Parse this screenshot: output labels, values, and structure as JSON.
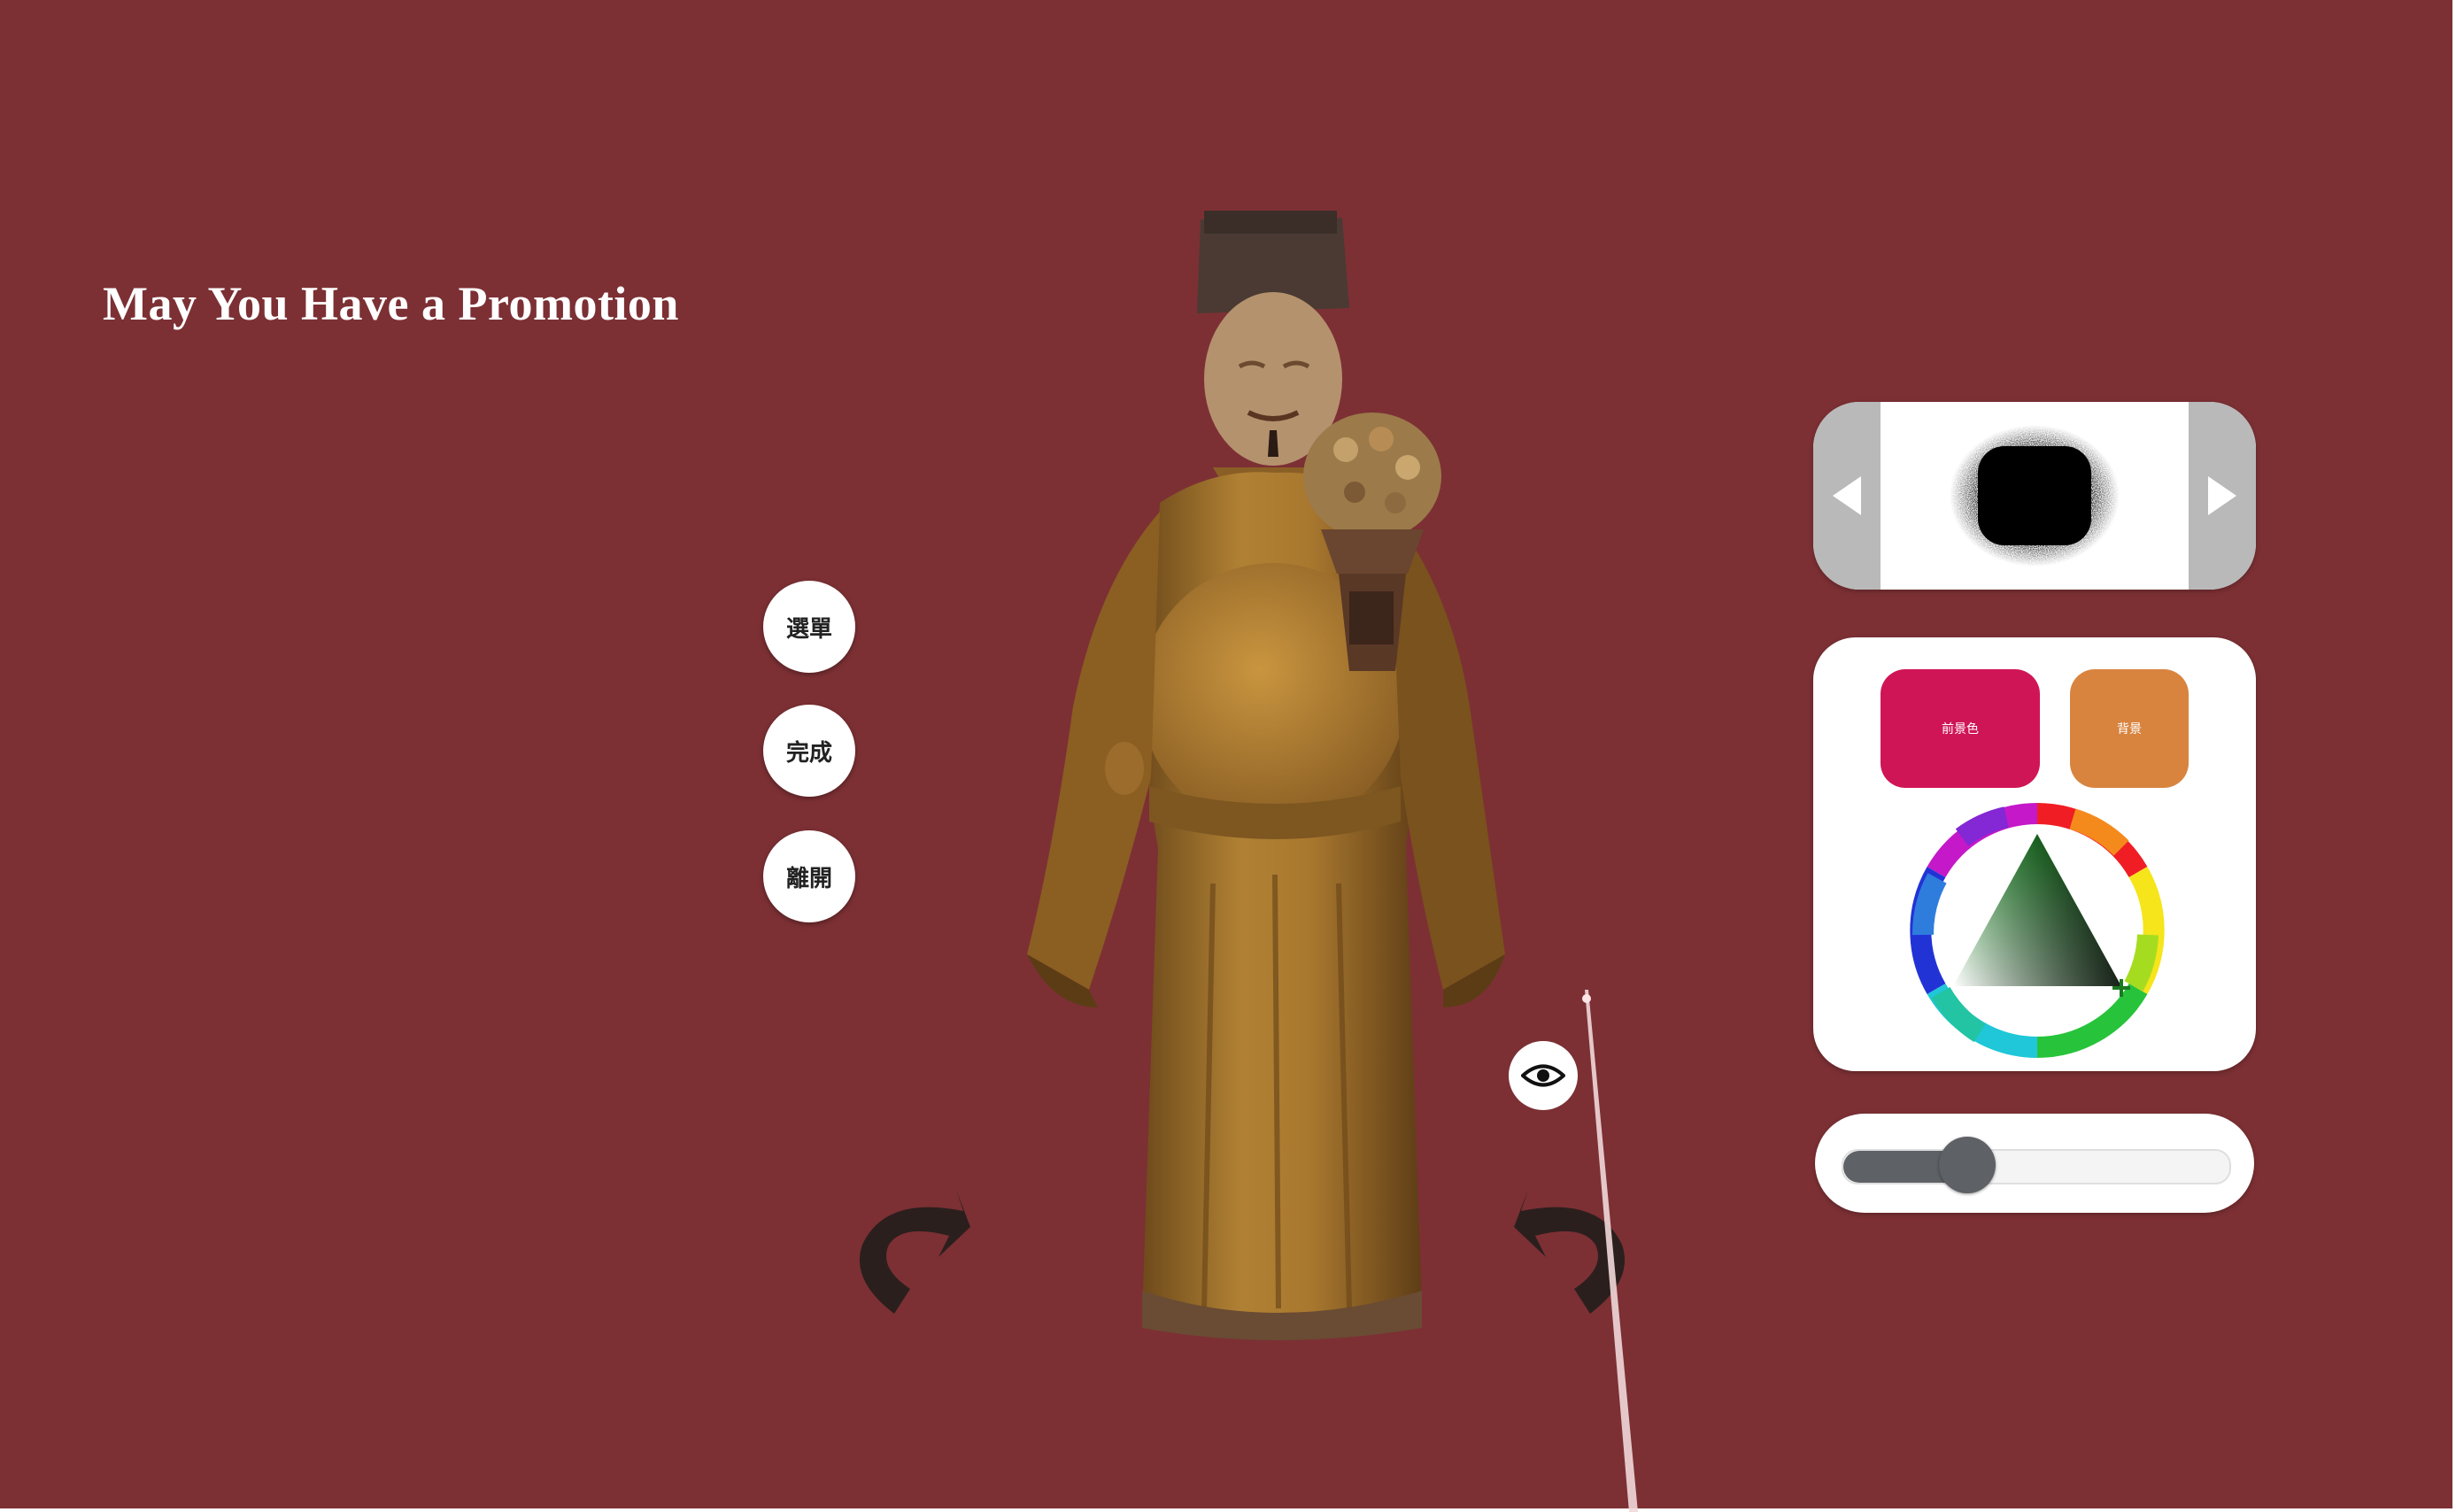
{
  "title": "May You Have a Promotion",
  "menu": {
    "menu_label": "選單",
    "done_label": "完成",
    "exit_label": "離開"
  },
  "tools": {
    "swatch_primary_label": "前景色",
    "swatch_secondary_label": "背景",
    "primary_color": "#cf1556",
    "secondary_color": "#d8843f"
  },
  "slider": {
    "level": 0.28
  },
  "icons": {
    "eye": "eye-icon",
    "rotate_left": "rotate-left-icon",
    "rotate_right": "rotate-right-icon",
    "prev": "triangle-left-icon",
    "next": "triangle-right-icon"
  },
  "colors": {
    "background": "#7c3034",
    "statue_robe": "#a7762f"
  }
}
